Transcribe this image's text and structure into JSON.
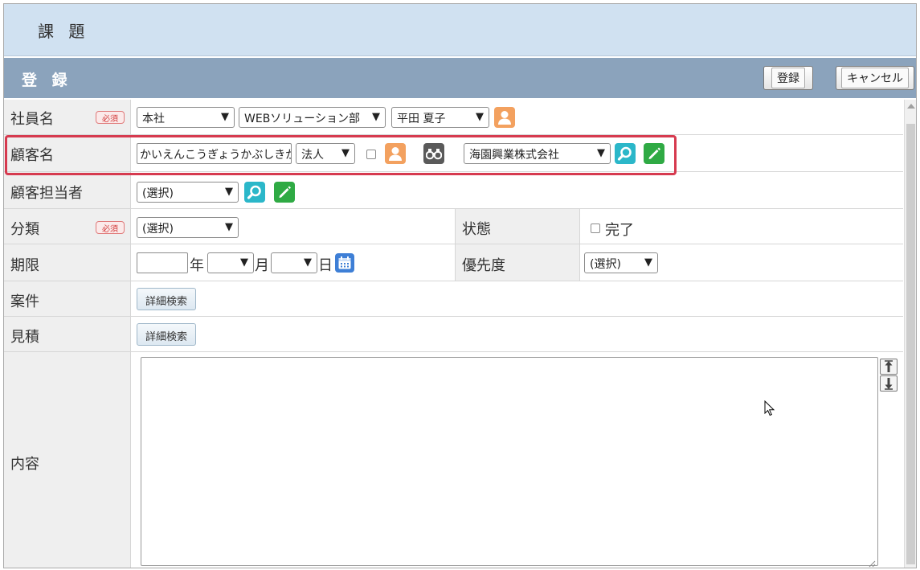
{
  "page": {
    "title": "課 題"
  },
  "section": {
    "title": "登 録",
    "register_label": "登録",
    "cancel_label": "キャンセル"
  },
  "required_badge": "必須",
  "fields": {
    "employee": {
      "label": "社員名",
      "office": "本社",
      "department": "WEBソリューション部",
      "person": "平田 夏子"
    },
    "customer": {
      "label": "顧客名",
      "kana": "かいえんこうぎょうかぶしきが",
      "type": "法人",
      "company": "海園興業株式会社"
    },
    "contact": {
      "label": "顧客担当者",
      "select": "(選択)"
    },
    "category": {
      "label": "分類",
      "select": "(選択)",
      "status_label": "状態",
      "status_option": "完了"
    },
    "deadline": {
      "label": "期限",
      "year_value": "",
      "year_unit": "年",
      "month_unit": "月",
      "day_unit": "日",
      "priority_label": "優先度",
      "priority_select": "(選択)"
    },
    "project": {
      "label": "案件",
      "button": "詳細検索"
    },
    "estimate": {
      "label": "見積",
      "button": "詳細検索"
    },
    "content": {
      "label": "内容",
      "value": ""
    }
  },
  "ui": {
    "dropdown_arrow": "▼"
  },
  "colors": {
    "title_bar": "#d0e1f1",
    "section_bar": "#8ba3bc",
    "highlight": "#d63a4f",
    "person_icon": "#f3a15f",
    "search_icon": "#2bb7c9",
    "edit_icon": "#2faa44",
    "required": "#d23b3b"
  },
  "icons": [
    "person-icon",
    "binoculars-icon",
    "search-icon",
    "pencil-icon",
    "calendar-icon",
    "arrow-up-icon",
    "arrow-down-icon",
    "resize-grip-icon",
    "mouse-cursor-icon"
  ]
}
